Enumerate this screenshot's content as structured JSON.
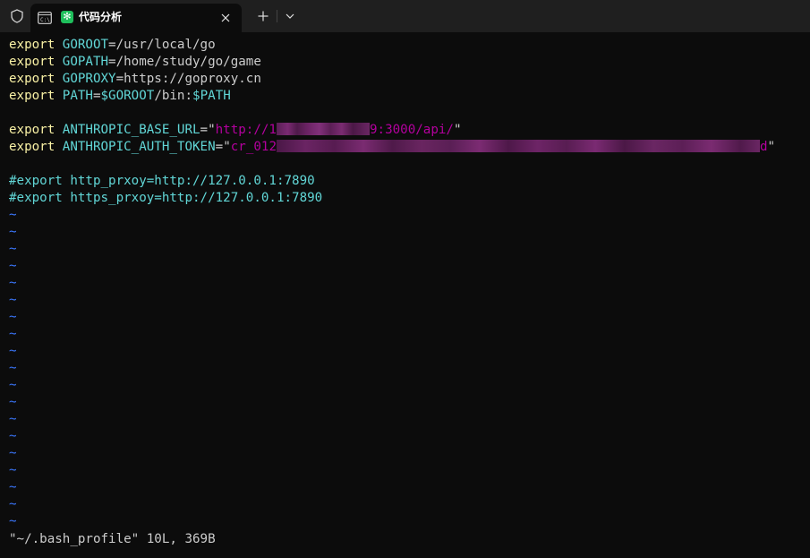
{
  "window": {
    "tab": {
      "title": "代码分析",
      "app_icon_glyph": "✻"
    },
    "new_tab_label": "+",
    "icons": [
      "shield-icon",
      "terminal-icon",
      "app-icon",
      "close-icon",
      "plus-icon",
      "chevron-down-icon"
    ]
  },
  "editor": {
    "lines": [
      {
        "kw": "export",
        "name": "GOROOT",
        "eq": "=",
        "val": "/usr/local/go"
      },
      {
        "kw": "export",
        "name": "GOPATH",
        "eq": "=",
        "val": "/home/study/go/game"
      },
      {
        "kw": "export",
        "name": "GOPROXY",
        "eq": "=",
        "val": "https://goproxy.cn"
      },
      {
        "kw": "export",
        "name": "PATH",
        "eq": "=",
        "val_var1": "$GOROOT",
        "val_mid": "/bin:",
        "val_var2": "$PATH"
      }
    ],
    "anthropic_base": {
      "kw": "export",
      "name": "ANTHROPIC_BASE_URL",
      "eq": "=",
      "quote_open": "\"",
      "val_prefix": "http://1",
      "val_suffix": "9:3000/api/",
      "quote_close": "\""
    },
    "anthropic_token": {
      "kw": "export",
      "name": "ANTHROPIC_AUTH_TOKEN",
      "eq": "=",
      "quote_open": "\"",
      "val_prefix": "cr_012",
      "val_suffix": "d",
      "quote_close": "\""
    },
    "comments": [
      "#export http_prxoy=http://127.0.0.1:7890",
      "#export https_prxoy=http://127.0.0.1:7890"
    ],
    "tilde": "~",
    "tilde_count": 19,
    "status_line": "\"~/.bash_profile\" 10L, 369B"
  },
  "colors": {
    "background": "#0c0c0c",
    "keyword": "#f9f1a5",
    "variable": "#61d6d6",
    "string": "#b4009e",
    "tilde": "#3b78ff",
    "text": "#cccccc"
  }
}
